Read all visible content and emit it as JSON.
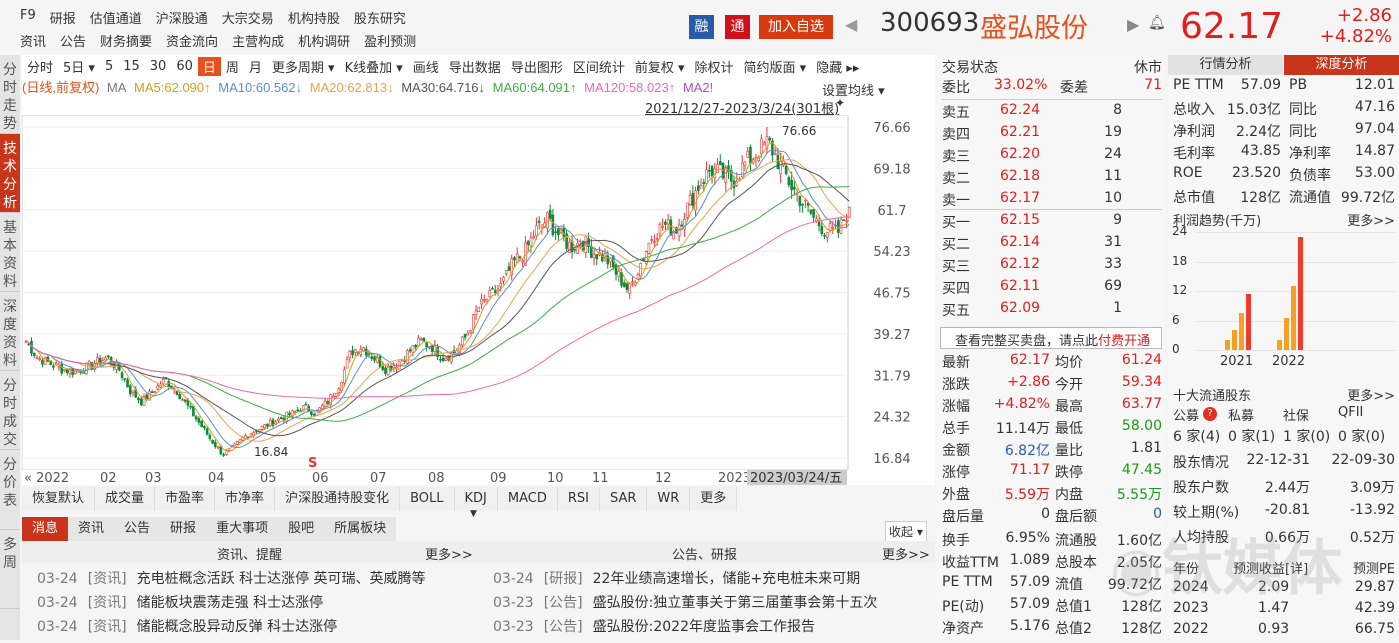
{
  "topnav": {
    "row1": [
      "F9",
      "研报",
      "估值通道",
      "沪深股通",
      "大宗交易",
      "机构持股",
      "股东研究"
    ],
    "row2": [
      "资讯",
      "公告",
      "财务摘要",
      "资金流向",
      "主营构成",
      "机构调研",
      "盈利预测"
    ]
  },
  "header": {
    "rong": "融",
    "tong": "通",
    "add_watch": "加入自选",
    "code": "300693",
    "name": "盛弘股份",
    "price": "62.17",
    "change": "+2.86",
    "change_pct": "+4.82%"
  },
  "sidebar": [
    "分时走势",
    "技术分析",
    "基本资料",
    "深度资料",
    "分时成交",
    "分价表",
    "多周"
  ],
  "toolbar": [
    "分时",
    "5日 ▾",
    "5",
    "15",
    "30",
    "60",
    "日",
    "周",
    "月",
    "更多周期 ▾",
    "K线叠加 ▾",
    "画线",
    "导出数据",
    "导出图形",
    "区间统计",
    "前复权 ▾",
    "除权计",
    "简约版面 ▾",
    "隐藏 ▸▸"
  ],
  "ma": {
    "mode": "(日线,前复权)",
    "ma": "MA",
    "ma5": "MA5:62.090↑",
    "ma10": "MA10:60.562↓",
    "ma20": "MA20:62.813↓",
    "ma30": "MA30:64.716↓",
    "ma60": "MA60:64.091↑",
    "ma120": "MA120:58.023↑",
    "ma250": "MA2!",
    "set_ma": "设置均线 ▾",
    "range": "2021/12/27-2023/3/24(301根)"
  },
  "chart_data": {
    "type": "candlestick",
    "yticks": [
      76.66,
      69.18,
      61.7,
      54.23,
      46.75,
      39.27,
      31.79,
      24.32,
      16.84
    ],
    "ylim": [
      16.84,
      76.66
    ],
    "xticks": [
      "« 2022",
      "02",
      "03",
      "04",
      "05",
      "06",
      "07",
      "08",
      "09",
      "10",
      "11",
      "12",
      "2023"
    ],
    "current_date": "2023/03/24/五",
    "high_label": "76.66",
    "low_label": "16.84",
    "marker": "S",
    "close_path": [
      38,
      35,
      34,
      33,
      32.5,
      33,
      34,
      35,
      33,
      29,
      27,
      29,
      31,
      29,
      26,
      23,
      20,
      17.5,
      19,
      21,
      22,
      23,
      24,
      25,
      26,
      25,
      27,
      30,
      36,
      37,
      35,
      33,
      34,
      36,
      38,
      37,
      35,
      36,
      39,
      44,
      46,
      48,
      52,
      54,
      58,
      60,
      57,
      55,
      56,
      54,
      53,
      50,
      47,
      52,
      57,
      59,
      58,
      62,
      66,
      69,
      68,
      67,
      70,
      72,
      74,
      70,
      66,
      63,
      60,
      58,
      57.5,
      62.17
    ],
    "ma_colors": {
      "ma5": "#d4a017",
      "ma10": "#5b8fd6",
      "ma20": "#f0a050",
      "ma30": "#555555",
      "ma60": "#3cb043",
      "ma120": "#f06aa8",
      "ma250": "#b050c0"
    }
  },
  "indicators": [
    "恢复默认",
    "成交量",
    "市盈率",
    "市净率",
    "沪深股通持股变化",
    "BOLL",
    "KDJ",
    "MACD",
    "RSI",
    "SAR",
    "WR",
    "更多"
  ],
  "news": {
    "tabs": [
      "消息",
      "资讯",
      "公告",
      "研报",
      "重大事项",
      "股吧",
      "所属板块"
    ],
    "collapse": "收起 ▾",
    "left_title": "资讯、提醒",
    "right_title": "公告、研报",
    "more": "更多>>",
    "left": [
      {
        "d": "03-24",
        "t": "[资讯]",
        "title": "充电桩概念活跃 科士达涨停 英可瑞、英威腾等"
      },
      {
        "d": "03-24",
        "t": "[资讯]",
        "title": "储能板块震荡走强 科士达涨停"
      },
      {
        "d": "03-24",
        "t": "[资讯]",
        "title": "储能概念股异动反弹 科士达涨停"
      }
    ],
    "right": [
      {
        "d": "03-24",
        "t": "[研报]",
        "title": "22年业绩高速增长，储能+充电桩未来可期"
      },
      {
        "d": "03-23",
        "t": "[公告]",
        "title": "盛弘股份:独立董事关于第三届董事会第十五次"
      },
      {
        "d": "03-23",
        "t": "[公告]",
        "title": "盛弘股份:2022年度监事会工作报告"
      }
    ]
  },
  "orderbook": {
    "status_label": "交易状态",
    "status": "休市",
    "wb_label": "委比",
    "wb": "33.02%",
    "wc_label": "委差",
    "wc": "71",
    "asks": [
      {
        "l": "卖五",
        "p": "62.24",
        "v": "8"
      },
      {
        "l": "卖四",
        "p": "62.21",
        "v": "19"
      },
      {
        "l": "卖三",
        "p": "62.20",
        "v": "24"
      },
      {
        "l": "卖二",
        "p": "62.18",
        "v": "11"
      },
      {
        "l": "卖一",
        "p": "62.17",
        "v": "10"
      }
    ],
    "bids": [
      {
        "l": "买一",
        "p": "62.15",
        "v": "9"
      },
      {
        "l": "买二",
        "p": "62.14",
        "v": "31"
      },
      {
        "l": "买三",
        "p": "62.12",
        "v": "33"
      },
      {
        "l": "买四",
        "p": "62.11",
        "v": "69"
      },
      {
        "l": "买五",
        "p": "62.09",
        "v": "1"
      }
    ],
    "full_text": "查看完整买卖盘，请点此",
    "full_link": "付费开通"
  },
  "quote": [
    [
      "最新",
      "62.17",
      "r",
      "均价",
      "61.24",
      "r"
    ],
    [
      "涨跌",
      "+2.86",
      "r",
      "今开",
      "59.34",
      "r"
    ],
    [
      "涨幅",
      "+4.82%",
      "r",
      "最高",
      "63.77",
      "r"
    ],
    [
      "总手",
      "11.14万",
      "",
      "最低",
      "58.00",
      "g"
    ],
    [
      "金额",
      "6.82亿",
      "b",
      "量比",
      "1.81",
      ""
    ],
    [
      "涨停",
      "71.17",
      "r",
      "跌停",
      "47.45",
      "g"
    ],
    [
      "外盘",
      "5.59万",
      "r",
      "内盘",
      "5.55万",
      "g"
    ],
    [
      "盘后量",
      "0",
      "",
      "盘后额",
      "0",
      "b"
    ],
    [
      "换手",
      "6.95%",
      "",
      "流通股",
      "1.60亿",
      ""
    ],
    [
      "收益TTM",
      "1.089",
      "",
      "总股本",
      "2.05亿",
      ""
    ],
    [
      "PE TTM",
      "57.09",
      "",
      "流值",
      "99.72亿",
      ""
    ],
    [
      "PE(动)",
      "57.09",
      "",
      "总值1",
      "128亿",
      ""
    ],
    [
      "净资产",
      "5.176",
      "",
      "总值2",
      "128亿",
      ""
    ]
  ],
  "analysis": {
    "tabs": [
      "行情分析",
      "深度分析"
    ],
    "rows": [
      [
        "PE TTM",
        "57.09",
        "PB",
        "12.01"
      ],
      [
        "总收入",
        "15.03亿",
        "同比",
        "47.16"
      ],
      [
        "净利润",
        "2.24亿",
        "同比",
        "97.04"
      ],
      [
        "毛利率",
        "43.85",
        "净利率",
        "14.87"
      ],
      [
        "ROE",
        "23.520",
        "负债率",
        "53.00"
      ],
      [
        "总市值",
        "128亿",
        "流通值",
        "99.72亿"
      ]
    ],
    "profit_title": "利润趋势(千万)",
    "more": "更多>>",
    "profit_chart": {
      "type": "bar",
      "yticks": [
        0,
        6,
        12,
        18,
        24
      ],
      "categories": [
        "2021",
        "2022"
      ],
      "series": [
        [
          2,
          4,
          7.6,
          11.4
        ],
        [
          2,
          6.5,
          13,
          23
        ]
      ]
    }
  },
  "holders": {
    "title": "十大流通股东",
    "more": "更多>>",
    "types": [
      "公募",
      "私募",
      "社保",
      "QFII"
    ],
    "counts": [
      "6 家(4)",
      "0 家(1)",
      "1 家(0)",
      "0 家(0)"
    ],
    "rows": [
      [
        "股东情况",
        "22-12-31",
        "22-09-30"
      ],
      [
        "股东户数",
        "2.44万",
        "3.09万"
      ],
      [
        "较上期(%)",
        "-20.81",
        "-13.92"
      ],
      [
        "人均持股",
        "0.66万",
        "0.52万"
      ]
    ]
  },
  "forecast": {
    "head": [
      "年份",
      "预测收益[详]",
      "预测PE"
    ],
    "rows": [
      [
        "2024",
        "2.09",
        "29.87"
      ],
      [
        "2023",
        "1.47",
        "42.39"
      ],
      [
        "2022",
        "0.93",
        "66.75"
      ]
    ]
  },
  "watermark": "钛媒体"
}
